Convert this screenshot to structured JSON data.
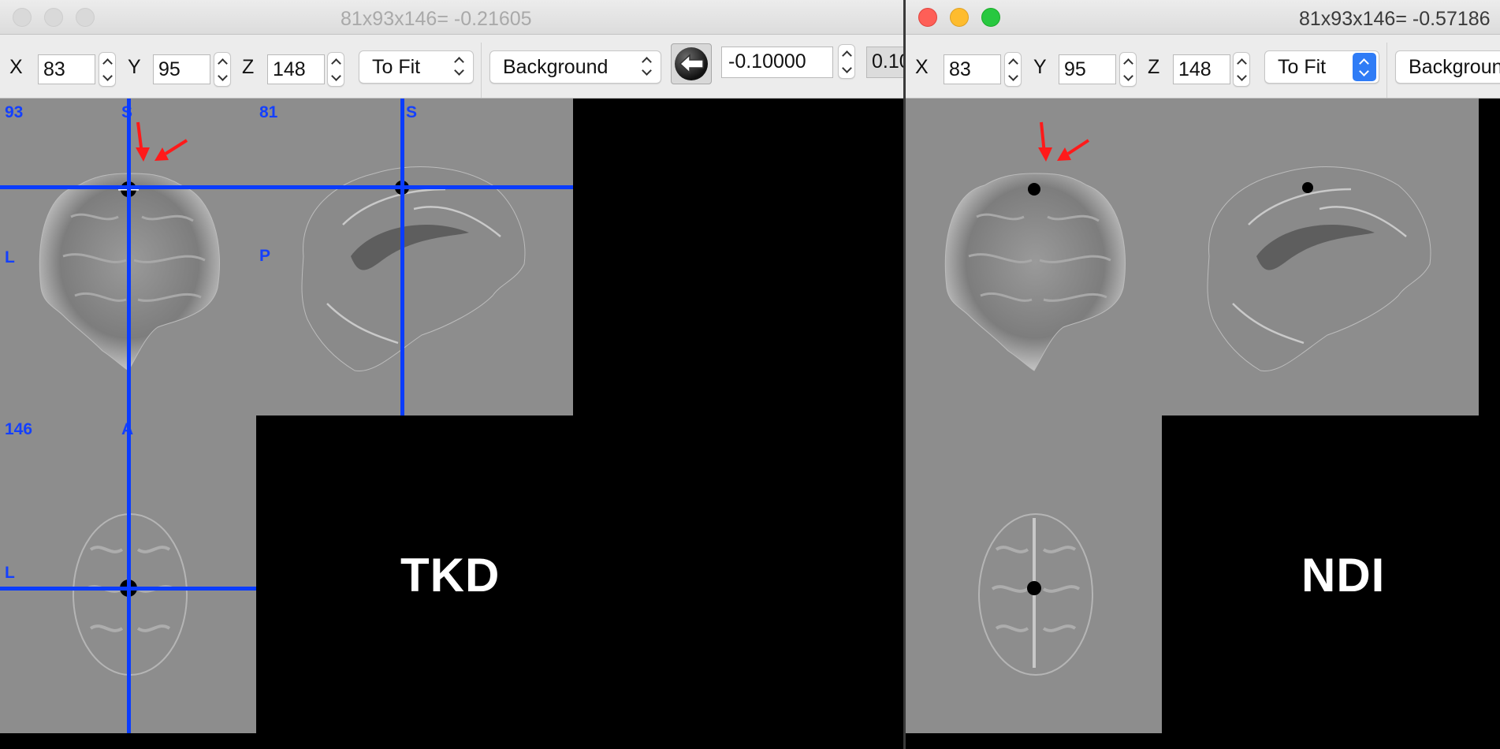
{
  "left_window": {
    "title": "81x93x146= -0.21605",
    "toolbar": {
      "x_label": "X",
      "x_value": "83",
      "y_label": "Y",
      "y_value": "95",
      "z_label": "Z",
      "z_value": "148",
      "zoom_value": "To Fit",
      "layer_value": "Background",
      "min_value": "-0.10000",
      "max_value_partial": "0.10"
    },
    "views": {
      "coronal_slice": "93",
      "coronal_top": "S",
      "coronal_left": "L",
      "sagittal_slice": "81",
      "sagittal_top": "S",
      "sagittal_left": "P",
      "axial_slice": "146",
      "axial_top": "A",
      "axial_left": "L"
    },
    "method_label": "TKD"
  },
  "right_window": {
    "title": "81x93x146= -0.57186",
    "toolbar": {
      "x_label": "X",
      "x_value": "83",
      "y_label": "Y",
      "y_value": "95",
      "z_label": "Z",
      "z_value": "148",
      "zoom_value": "To Fit",
      "layer_value": "Background"
    },
    "method_label": "NDI"
  },
  "colors": {
    "crosshair": "#0a3cff",
    "annotation_arrow": "#ff1a1a",
    "panel_background": "#8d8d8d"
  }
}
